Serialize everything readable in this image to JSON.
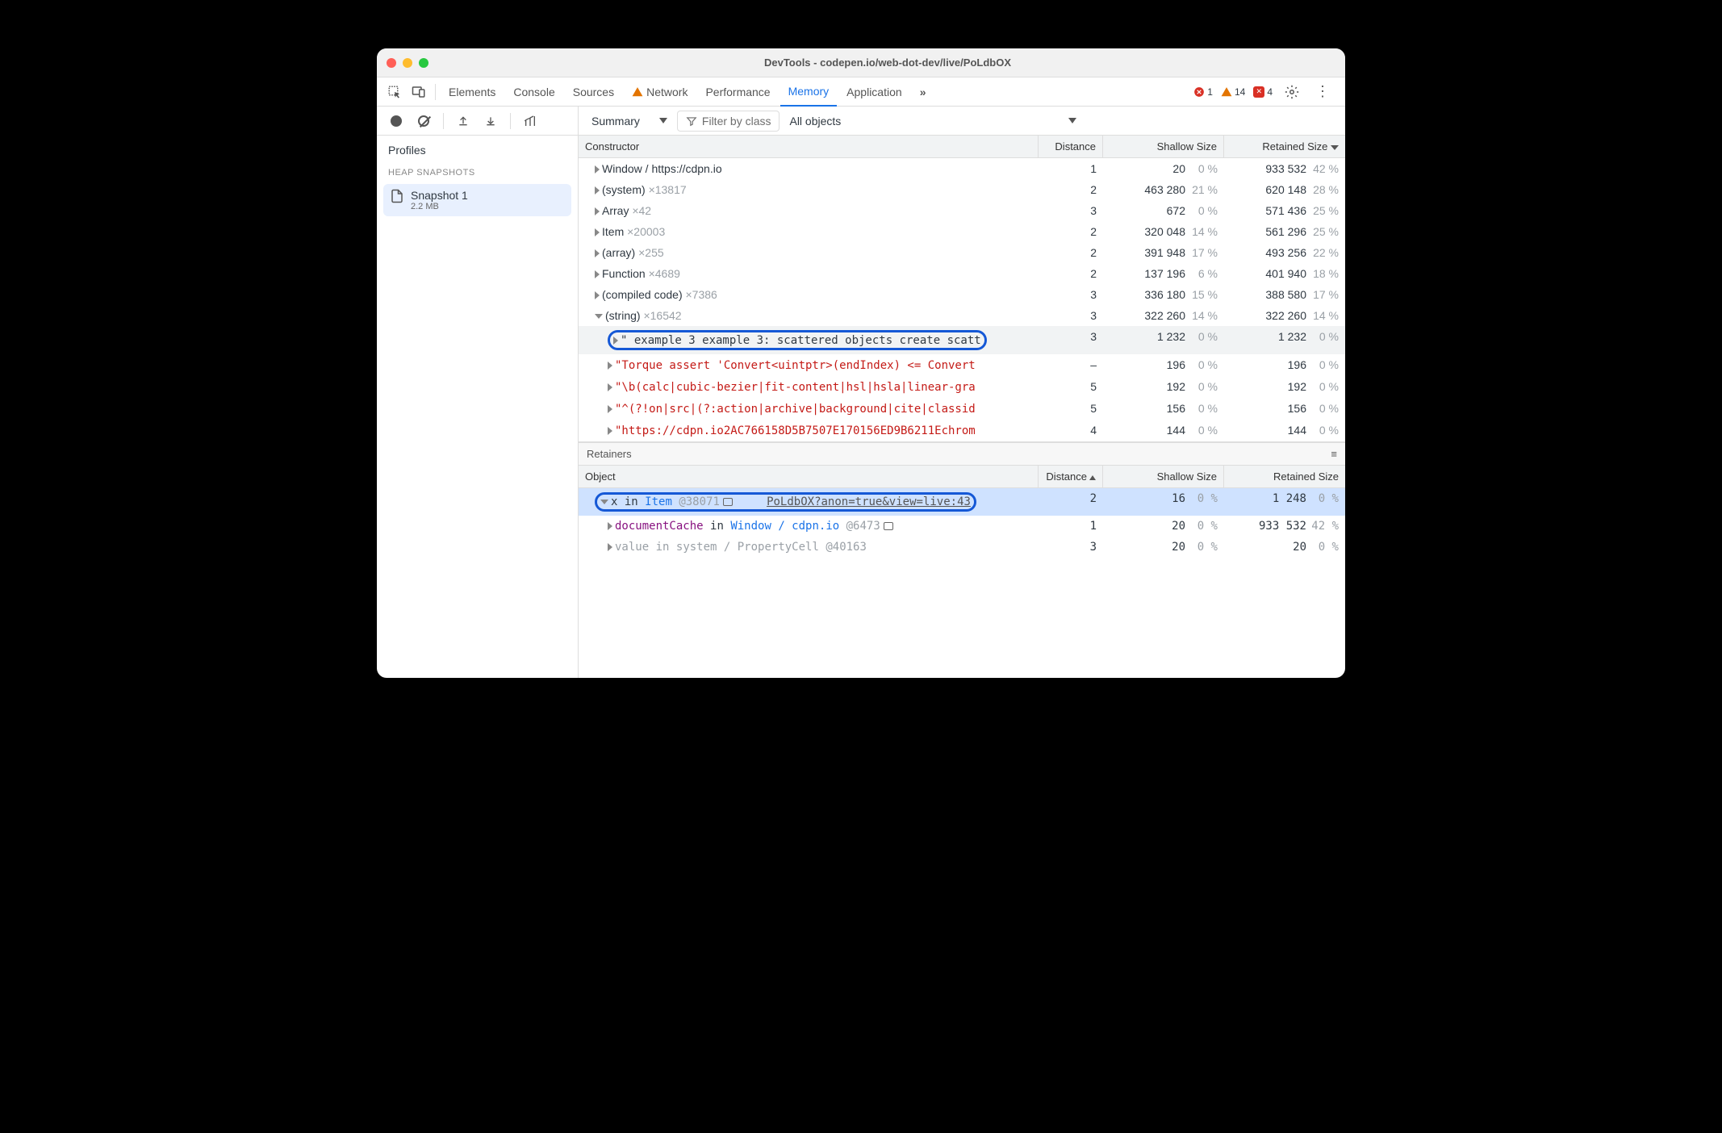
{
  "window": {
    "title": "DevTools - codepen.io/web-dot-dev/live/PoLdbOX"
  },
  "tabs": {
    "elements": "Elements",
    "console": "Console",
    "sources": "Sources",
    "network": "Network",
    "performance": "Performance",
    "memory": "Memory",
    "application": "Application"
  },
  "toolbar_counts": {
    "errors": "1",
    "warnings": "14",
    "issues": "4"
  },
  "left_panel": {
    "profiles": "Profiles",
    "heap": "HEAP SNAPSHOTS",
    "snapshot": {
      "name": "Snapshot 1",
      "size": "2.2 MB"
    }
  },
  "right_toolbar": {
    "summary": "Summary",
    "filter_placeholder": "Filter by class",
    "all_objects": "All objects"
  },
  "columns": {
    "constructor": "Constructor",
    "distance": "Distance",
    "shallow": "Shallow Size",
    "retained": "Retained Size"
  },
  "rows": [
    {
      "name": "Window / https://cdpn.io",
      "count": "",
      "dist": "1",
      "ssize": "20",
      "spct": "0 %",
      "rsize": "933 532",
      "rpct": "42 %",
      "indent": 1
    },
    {
      "name": "(system)",
      "count": "×13817",
      "dist": "2",
      "ssize": "463 280",
      "spct": "21 %",
      "rsize": "620 148",
      "rpct": "28 %",
      "indent": 1
    },
    {
      "name": "Array",
      "count": "×42",
      "dist": "3",
      "ssize": "672",
      "spct": "0 %",
      "rsize": "571 436",
      "rpct": "25 %",
      "indent": 1
    },
    {
      "name": "Item",
      "count": "×20003",
      "dist": "2",
      "ssize": "320 048",
      "spct": "14 %",
      "rsize": "561 296",
      "rpct": "25 %",
      "indent": 1
    },
    {
      "name": "(array)",
      "count": "×255",
      "dist": "2",
      "ssize": "391 948",
      "spct": "17 %",
      "rsize": "493 256",
      "rpct": "22 %",
      "indent": 1
    },
    {
      "name": "Function",
      "count": "×4689",
      "dist": "2",
      "ssize": "137 196",
      "spct": "6 %",
      "rsize": "401 940",
      "rpct": "18 %",
      "indent": 1
    },
    {
      "name": "(compiled code)",
      "count": "×7386",
      "dist": "3",
      "ssize": "336 180",
      "spct": "15 %",
      "rsize": "388 580",
      "rpct": "17 %",
      "indent": 1
    },
    {
      "name": "(string)",
      "count": "×16542",
      "dist": "3",
      "ssize": "322 260",
      "spct": "14 %",
      "rsize": "322 260",
      "rpct": "14 %",
      "indent": 1,
      "open": true
    }
  ],
  "string_children": [
    {
      "text": "\" example 3 example 3: scattered objects create scatt",
      "dist": "3",
      "ssize": "1 232",
      "spct": "0 %",
      "rsize": "1 232",
      "rpct": "0 %",
      "hl": true,
      "ring": true,
      "black": true
    },
    {
      "text": "\"Torque assert 'Convert<uintptr>(endIndex) <= Convert",
      "dist": "–",
      "ssize": "196",
      "spct": "0 %",
      "rsize": "196",
      "rpct": "0 %"
    },
    {
      "text": "\"\\b(calc|cubic-bezier|fit-content|hsl|hsla|linear-gra",
      "dist": "5",
      "ssize": "192",
      "spct": "0 %",
      "rsize": "192",
      "rpct": "0 %"
    },
    {
      "text": "\"^(?!on|src|(?:action|archive|background|cite|classid",
      "dist": "5",
      "ssize": "156",
      "spct": "0 %",
      "rsize": "156",
      "rpct": "0 %"
    },
    {
      "text": "\"https://cdpn.io2AC766158D5B7507E170156ED9B6211Echrom",
      "dist": "4",
      "ssize": "144",
      "spct": "0 %",
      "rsize": "144",
      "rpct": "0 %"
    }
  ],
  "retainers": {
    "title": "Retainers",
    "columns": {
      "object": "Object",
      "distance": "Distance",
      "shallow": "Shallow Size",
      "retained": "Retained Size"
    },
    "rows": [
      {
        "prefix": "x",
        "mid": "in",
        "obj": "Item",
        "loc": "@38071",
        "link": "PoLdbOX?anon=true&view=live:43",
        "dist": "2",
        "ssize": "16",
        "spct": "0 %",
        "rsize": "1 248",
        "rpct": "0 %",
        "sel": true,
        "open": true,
        "ring": true,
        "box": true
      },
      {
        "prefix": "documentCache",
        "mid": "in",
        "obj": "Window / cdpn.io",
        "loc": "@6473",
        "dist": "1",
        "ssize": "20",
        "spct": "0 %",
        "rsize": "933 532",
        "rpct": "42 %",
        "box": true,
        "indent": 2,
        "prop": true
      },
      {
        "prefix": "value",
        "mid": "in",
        "obj": "system / PropertyCell",
        "loc": "@40163",
        "dist": "3",
        "ssize": "20",
        "spct": "0 %",
        "rsize": "20",
        "rpct": "0 %",
        "indent": 2,
        "dim": true
      }
    ]
  }
}
